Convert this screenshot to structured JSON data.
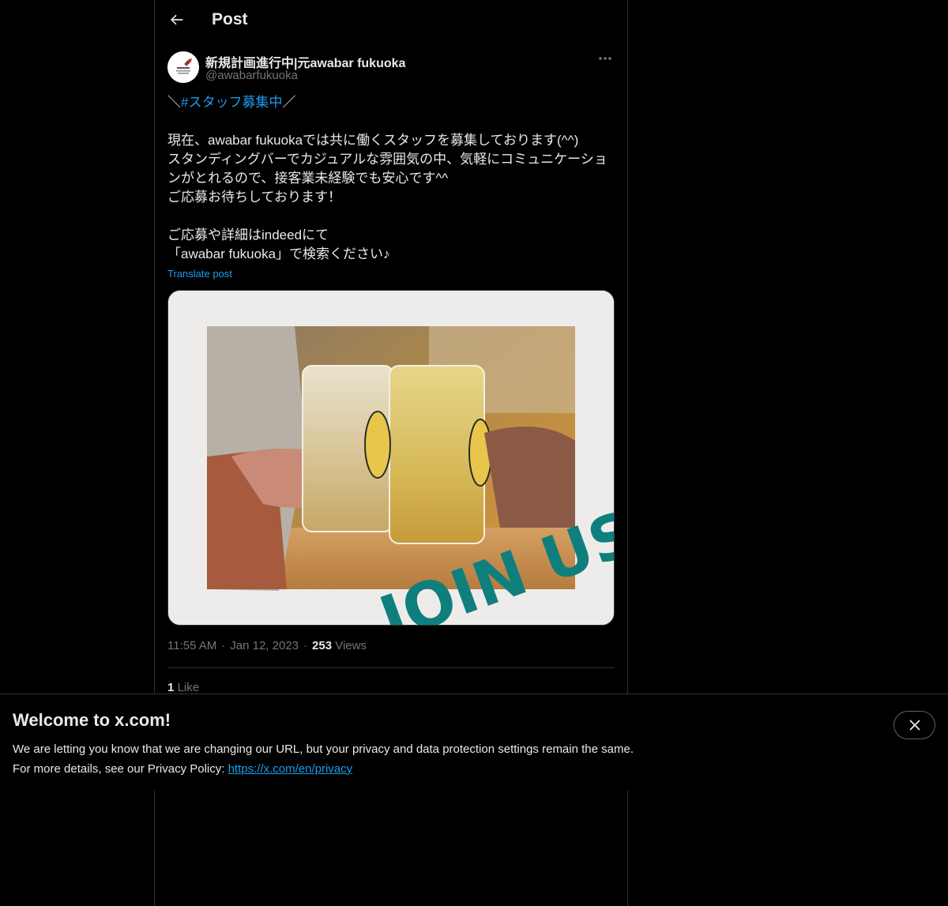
{
  "header": {
    "title": "Post",
    "back_icon": "arrow-left-icon"
  },
  "author": {
    "display_name": "新規計画進行中|元awabar fukuoka",
    "handle": "@awabarfukuoka",
    "avatar_icon": "rocket-icon"
  },
  "post": {
    "hashtag_prefix": "＼",
    "hashtag": "#スタッフ募集中",
    "hashtag_suffix": "／",
    "lines": [
      "",
      "現在、awabar fukuokaでは共に働くスタッフを募集しております(^^)",
      "スタンディングバーでカジュアルな雰囲気の中、気軽にコミュニケーショ",
      "ンがとれるので、接客業未経験でも安心です^^",
      "ご応募お待ちしております！",
      "",
      "ご応募や詳細はindeedにて",
      "「awabar fukuoka」で検索ください♪"
    ],
    "translate_label": "Translate post",
    "image_overlay_text": "JOIN US",
    "time": "11:55 AM",
    "date": "Jan 12, 2023",
    "separator": "·",
    "views_count": "253",
    "views_label": "Views",
    "likes_count": "1",
    "likes_label": "Like"
  },
  "banner": {
    "title": "Welcome to x.com!",
    "line1": "We are letting you know that we are changing our URL, but your privacy and data protection settings remain the same.",
    "line2_prefix": "For more details, see our Privacy Policy: ",
    "link": "https://x.com/en/privacy"
  },
  "colors": {
    "accent": "#1d9bf0",
    "border": "#2f3336",
    "muted": "#71767b",
    "text": "#e7e9ea",
    "overlay_teal": "#0f7f7e"
  }
}
